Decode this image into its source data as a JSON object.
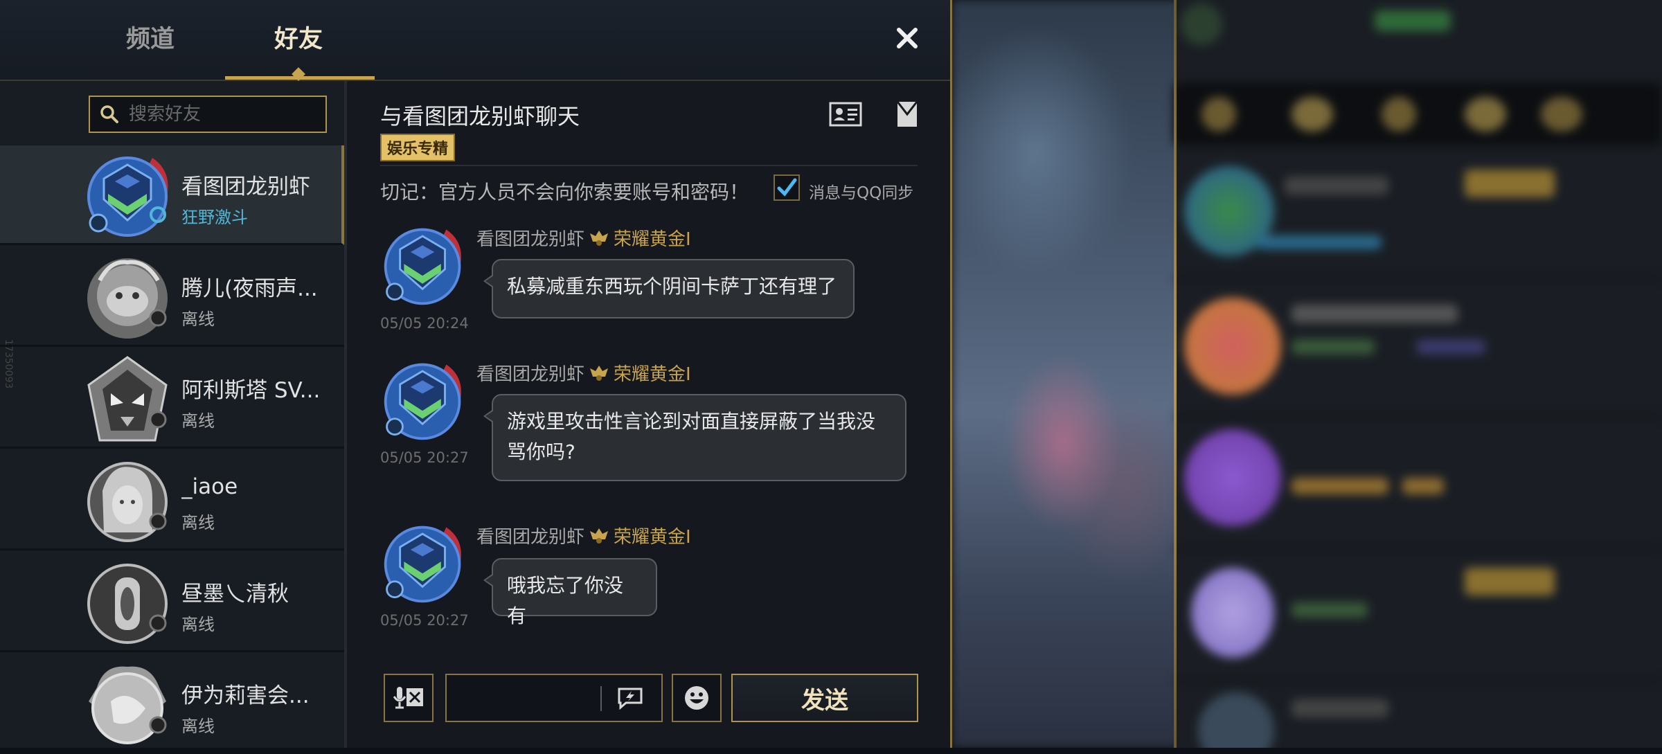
{
  "tabs": [
    {
      "label": "频道",
      "active": false
    },
    {
      "label": "好友",
      "active": true
    }
  ],
  "search": {
    "placeholder": "搜索好友",
    "value": ""
  },
  "friends": [
    {
      "name": "看图团龙别虾",
      "status": "狂野激斗",
      "online": true
    },
    {
      "name": "腾儿(夜雨声...",
      "status": "离线",
      "online": false
    },
    {
      "name": "阿利斯塔 SV...",
      "status": "离线",
      "online": false
    },
    {
      "name": "_iaoe",
      "status": "离线",
      "online": false
    },
    {
      "name": "昼墨乀清秋",
      "status": "离线",
      "online": false
    },
    {
      "name": "伊为莉害会...",
      "status": "离线",
      "online": false
    }
  ],
  "side_id": "17350093",
  "chat": {
    "title": "与看图团龙别虾聊天",
    "tag": "娱乐专精",
    "warning": "切记：官方人员不会向你索要账号和密码！",
    "sync_label": "消息与QQ同步",
    "sync_checked": true,
    "messages": [
      {
        "sender": "看图团龙别虾",
        "rank": "荣耀黄金I",
        "time": "05/05 20:24",
        "text": "私募减重东西玩个阴间卡萨丁还有理了"
      },
      {
        "sender": "看图团龙别虾",
        "rank": "荣耀黄金I",
        "time": "05/05 20:27",
        "text": "游戏里攻击性言论到对面直接屏蔽了当我没骂你吗?"
      },
      {
        "sender": "看图团龙别虾",
        "rank": "荣耀黄金I",
        "time": "05/05 20:27",
        "text": "哦我忘了你没有"
      }
    ]
  },
  "input": {
    "value": "",
    "send_label": "发送"
  },
  "colors": {
    "gold": "#c9a44e",
    "online": "#4fb8d8",
    "bubble": "#2b2f34",
    "badge": "#e4c066"
  },
  "icons": [
    "close-icon",
    "search-icon",
    "profile-card-icon",
    "mail-icon",
    "checkmark-icon",
    "voice-icon",
    "quick-message-icon",
    "emoji-icon"
  ]
}
